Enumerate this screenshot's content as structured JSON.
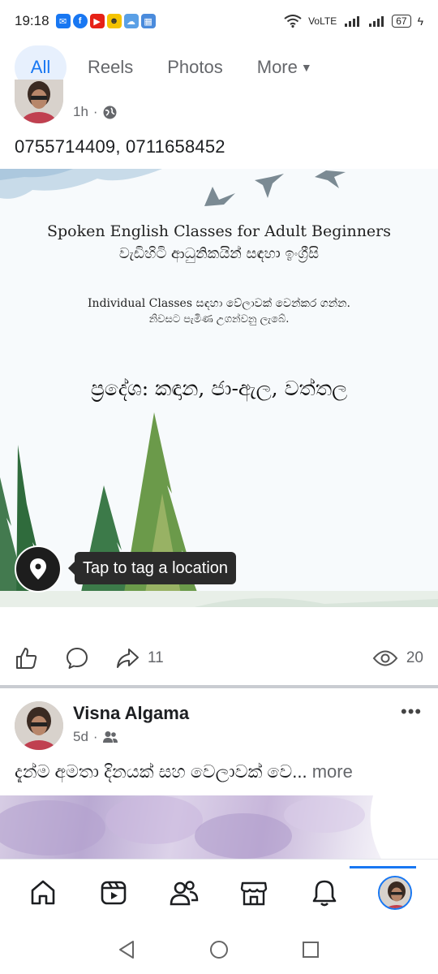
{
  "status_bar": {
    "time": "19:18",
    "network": "VoLTE",
    "battery": "67"
  },
  "tabs": [
    {
      "label": "All"
    },
    {
      "label": "Reels"
    },
    {
      "label": "Photos"
    },
    {
      "label": "More"
    }
  ],
  "post1": {
    "time": "1h",
    "audience_icon": "globe-icon",
    "text": "0755714409, 0711658452",
    "image": {
      "title": "Spoken English Classes for Adult Beginners",
      "sinhala_line": "වැඩිහිටි ආධුනිකයින් සඳහා ඉංග්‍රීසි",
      "line2": "Individual Classes සඳහා වේලාවක් වෙන්කර ගන්න.",
      "line3": "නිවසට පැමිණ උගන්වනු ලැබේ.",
      "region": "ප්‍රදේශ: කඳාන, ජා-ඇල, වත්තල"
    },
    "tag_tooltip": "Tap to tag a location",
    "share_count": "11",
    "view_count": "20"
  },
  "post2": {
    "author": "Visna Algama",
    "time": "5d",
    "audience_icon": "friends-icon",
    "text": "දැන්ම අමතා දිනයක් සහ වෙලාවක් වෙ...",
    "more_label": "more"
  },
  "colors": {
    "accent": "#1877f2",
    "muted": "#65676b",
    "active_tab_bg": "#e7f0fd"
  }
}
